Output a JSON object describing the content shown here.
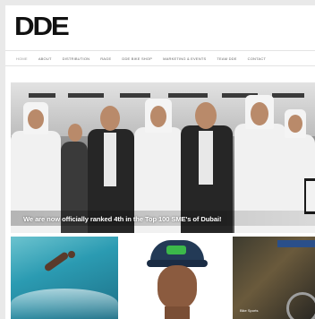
{
  "header": {
    "logo_text": "DDE"
  },
  "nav": {
    "items": [
      {
        "label": "HOME"
      },
      {
        "label": "ABOUT"
      },
      {
        "label": "DISTRIBUTION"
      },
      {
        "label": "RAGE"
      },
      {
        "label": "DDE BIKE SHOP"
      },
      {
        "label": "MARKETING & EVENTS"
      },
      {
        "label": "TEAM DDE"
      },
      {
        "label": "CONTACT"
      }
    ]
  },
  "hero": {
    "caption": "We are now officially ranked 4th in the Top 100 SME's of Dubai!"
  },
  "thumbs": [
    {
      "label": ""
    },
    {
      "label": ""
    },
    {
      "label": "Bike Sports"
    }
  ],
  "colors": {
    "page_bg": "#ffffff",
    "outer_bg": "#e9e9e9",
    "logo": "#111111",
    "nav_text": "#666666",
    "caption_text": "#ffffff"
  }
}
